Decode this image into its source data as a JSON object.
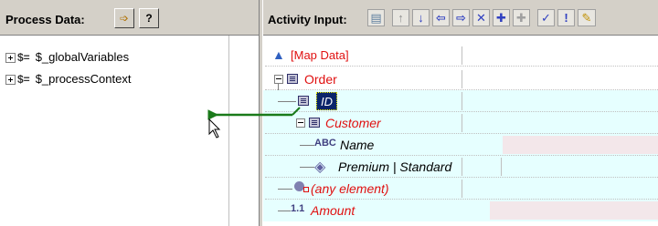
{
  "left": {
    "title": "Process Data:",
    "toolbar": [
      {
        "icon": "map-right-icon",
        "glyph": "➩"
      },
      {
        "icon": "help-icon",
        "glyph": "?"
      }
    ],
    "tree": [
      {
        "label": "$_globalVariables",
        "icon": "dollar-var-icon",
        "glyph": "$="
      },
      {
        "label": "$_processContext",
        "icon": "dollar-var-icon",
        "glyph": "$="
      }
    ]
  },
  "right": {
    "title": "Activity Input:",
    "toolbar": [
      {
        "icon": "grid-view-icon",
        "glyph": "▤"
      },
      {
        "icon": "arrow-up-icon",
        "glyph": "↑"
      },
      {
        "icon": "arrow-down-icon",
        "glyph": "↓"
      },
      {
        "icon": "arrow-left-icon",
        "glyph": "⇦"
      },
      {
        "icon": "arrow-right-icon",
        "glyph": "⇨"
      },
      {
        "icon": "delete-x-icon",
        "glyph": "✕"
      },
      {
        "icon": "add-plus-icon",
        "glyph": "✚"
      },
      {
        "icon": "add-child-icon",
        "glyph": "✚"
      },
      {
        "icon": "check-icon",
        "glyph": "✓"
      },
      {
        "icon": "exclamation-icon",
        "glyph": "!"
      },
      {
        "icon": "pencil-icon",
        "glyph": "✎"
      }
    ],
    "tree": {
      "map_data": "[Map Data]",
      "order": "Order",
      "id": "ID",
      "customer": "Customer",
      "name": "Name",
      "choice": "Premium | Standard",
      "any_element": "(any element)",
      "amount": "Amount"
    }
  },
  "colors": {
    "required": "#e01010",
    "highlight_row": "#e6ffff",
    "selected": "#0a246a",
    "value_box": "#f3e7ea",
    "mapping_arrow": "#1a7a1a"
  }
}
